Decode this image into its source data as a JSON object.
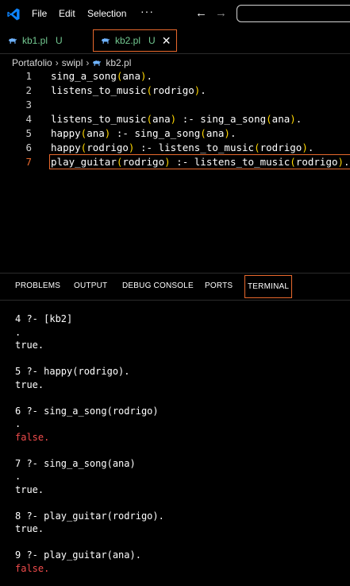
{
  "titlebar": {
    "menu": [
      "File",
      "Edit",
      "Selection"
    ],
    "more": "···",
    "back_arrow": "←",
    "forward_arrow": "→",
    "logo_icon": "vscode-logo",
    "logo_color": "#0d84ff"
  },
  "tabs": [
    {
      "name": "kb1.pl",
      "status": "U",
      "icon": "prolog-camel-icon"
    },
    {
      "name": "kb2.pl",
      "status": "U",
      "close": "✕",
      "icon": "prolog-camel-icon"
    }
  ],
  "breadcrumb": {
    "parts": [
      "Portafolio",
      "swipl",
      "kb2.pl"
    ],
    "sep": "›"
  },
  "editor": {
    "line_numbers": [
      "1",
      "2",
      "3",
      "4",
      "5",
      "6",
      "7"
    ],
    "active_line": 7,
    "lines": [
      "sing_a_song(ana).",
      "listens_to_music(rodrigo).",
      "",
      "listens_to_music(ana) :- sing_a_song(ana).",
      "happy(ana) :- sing_a_song(ana).",
      "happy(rodrigo) :- listens_to_music(rodrigo).",
      "play_guitar(rodrigo) :- listens_to_music(rodrigo)."
    ]
  },
  "panel": {
    "tabs": [
      "PROBLEMS",
      "OUTPUT",
      "DEBUG CONSOLE",
      "PORTS",
      "TERMINAL"
    ],
    "active_tab": "TERMINAL"
  },
  "terminal": {
    "lines": [
      "4 ?- [kb2]",
      ".",
      "true.",
      "",
      "5 ?- happy(rodrigo).",
      "true.",
      "",
      "6 ?- sing_a_song(rodrigo)",
      ".",
      "false.",
      "",
      "7 ?- sing_a_song(ana)",
      ".",
      "true.",
      "",
      "8 ?- play_guitar(rodrigo).",
      "true.",
      "",
      "9 ?- play_guitar(ana).",
      "false."
    ],
    "false_color": "#f14c4c"
  },
  "colors": {
    "accent": "#e8692d",
    "untracked": "#73c991",
    "bracket": "#ffd700"
  }
}
